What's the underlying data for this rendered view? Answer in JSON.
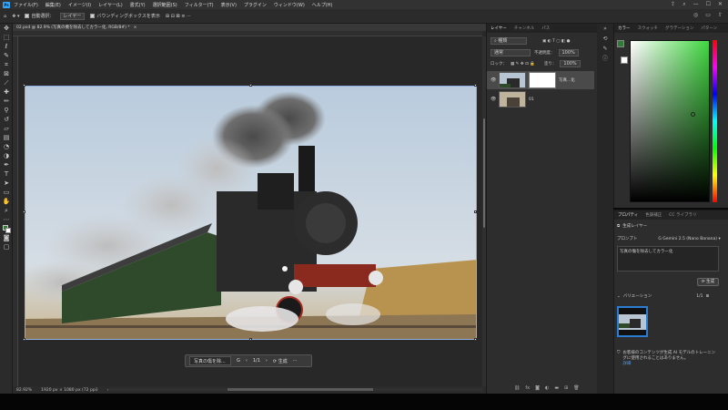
{
  "menubar": {
    "logo": "Ps",
    "items": [
      "ファイル(F)",
      "編集(E)",
      "イメージ(I)",
      "レイヤー(L)",
      "書式(Y)",
      "選択範囲(S)",
      "フィルター(T)",
      "表示(V)",
      "プラグイン",
      "ウィンドウ(W)",
      "ヘルプ(H)"
    ]
  },
  "options": {
    "auto_select_label": "自動選択：",
    "layer_dropdown": "レイヤー",
    "bbox_label": "バウンディングボックスを表示"
  },
  "document": {
    "tab_title": "02.psd @ 82.9% (写真の機を除去してカラー化, RGB/8#) *",
    "close": "×"
  },
  "context_bar": {
    "prompt": "写真の傷を除...",
    "page": "1/1",
    "generate": "生成"
  },
  "status": {
    "zoom": "82.92%",
    "doc_info": "1920 px × 1080 px (72 ppi)"
  },
  "layers_panel": {
    "tabs": [
      "レイヤー",
      "チャンネル",
      "パス"
    ],
    "search": "種類",
    "blend_mode": "通常",
    "opacity_label": "不透明度：",
    "opacity_value": "100%",
    "lock_label": "ロック：",
    "fill_label": "塗り：",
    "fill_value": "100%",
    "layers": [
      {
        "name": "写真...化",
        "visible": true
      },
      {
        "name": "01",
        "visible": true
      }
    ]
  },
  "color_panel": {
    "tabs": [
      "カラー",
      "スウォッチ",
      "グラデーション",
      "パターン"
    ],
    "accent": "#3fd63f"
  },
  "properties_panel": {
    "tabs": [
      "プロパティ",
      "色調補正",
      "CC ライブラリ"
    ],
    "layer_type": "生成レイヤー",
    "prompt_label": "プロンプト",
    "model": "Gemini 2.5 (Nano Banana)",
    "prompt_text": "写真の傷を除去してカラー化",
    "generate_button": "生成",
    "variations_label": "バリエーション",
    "variations_page": "1/1",
    "notice": "お客様のコンテンツが生成 AI モデルのトレーニングに使用されることはありません。",
    "notice_link": "詳細"
  }
}
